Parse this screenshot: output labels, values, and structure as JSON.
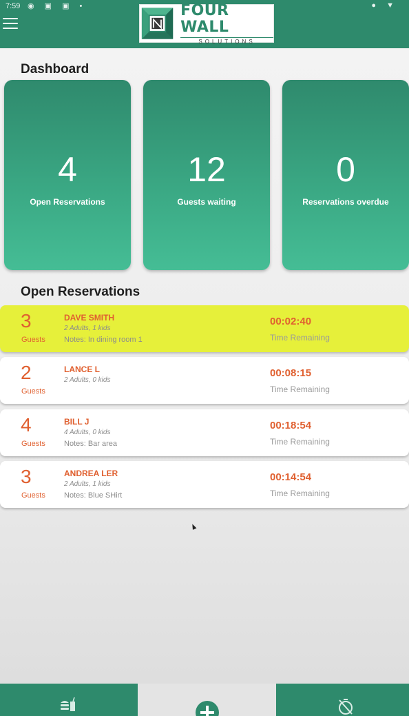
{
  "status_bar": {
    "time": "7:59"
  },
  "app": {
    "logo_title": "FOUR WALL",
    "logo_subtitle": "SOLUTIONS",
    "brand_color": "#2e8a6c",
    "accent_color": "#e06030",
    "highlight_color": "#e6f03a"
  },
  "dashboard": {
    "title": "Dashboard",
    "cards": [
      {
        "value": "4",
        "label": "Open Reservations"
      },
      {
        "value": "12",
        "label": "Guests waiting"
      },
      {
        "value": "0",
        "label": "Reservations overdue"
      }
    ]
  },
  "reservations": {
    "title": "Open Reservations",
    "items": [
      {
        "count": "3",
        "guests_label": "Guests",
        "name": "DAVE SMITH",
        "party": "2 Adults, 1 kids",
        "notes": "Notes: In dining room 1",
        "time": "00:02:40",
        "time_label": "Time Remaining",
        "highlighted": true
      },
      {
        "count": "2",
        "guests_label": "Guests",
        "name": "LANCE L",
        "party": "2 Adults, 0 kids",
        "notes": "",
        "time": "00:08:15",
        "time_label": "Time Remaining",
        "highlighted": false
      },
      {
        "count": "4",
        "guests_label": "Guests",
        "name": "BILL J",
        "party": "4 Adults, 0 kids",
        "notes": "Notes: Bar area",
        "time": "00:18:54",
        "time_label": "Time Remaining",
        "highlighted": false
      },
      {
        "count": "3",
        "guests_label": "Guests",
        "name": "ANDREA LER",
        "party": "2 Adults, 1 kids",
        "notes": "Notes: Blue SHirt",
        "time": "00:14:54",
        "time_label": "Time Remaining",
        "highlighted": false
      }
    ]
  },
  "bottom_nav": {
    "items": [
      {
        "icon": "food-drink-icon"
      },
      {
        "icon": "add-circle-icon"
      },
      {
        "icon": "timer-off-icon"
      }
    ]
  }
}
